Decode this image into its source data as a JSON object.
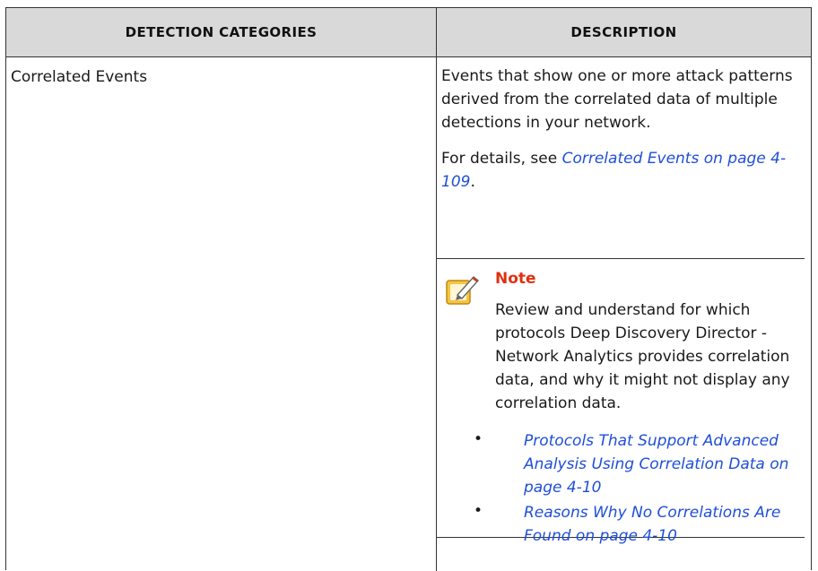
{
  "table": {
    "headers": [
      "DETECTION CATEGORIES",
      "DESCRIPTION"
    ],
    "rows": [
      {
        "category": "Correlated Events",
        "description": "Events that show one or more attack patterns derived from the correlated data of multiple detections in your network.",
        "details_prefix": "For details, see ",
        "details_link": "Correlated Events on page 4-109",
        "details_suffix": ".",
        "note": {
          "title": "Note",
          "body": "Review and understand for which protocols Deep Discovery Director - Network Analytics provides correlation data, and why it might not display any correlation data.",
          "bullets": [
            "Protocols That Support Advanced Analysis Using Correlation Data on page 4-10",
            "Reasons Why No Correlations Are Found on page 4-10"
          ],
          "bullet_glyph": "•",
          "icon": "note-pencil-icon"
        }
      }
    ]
  }
}
